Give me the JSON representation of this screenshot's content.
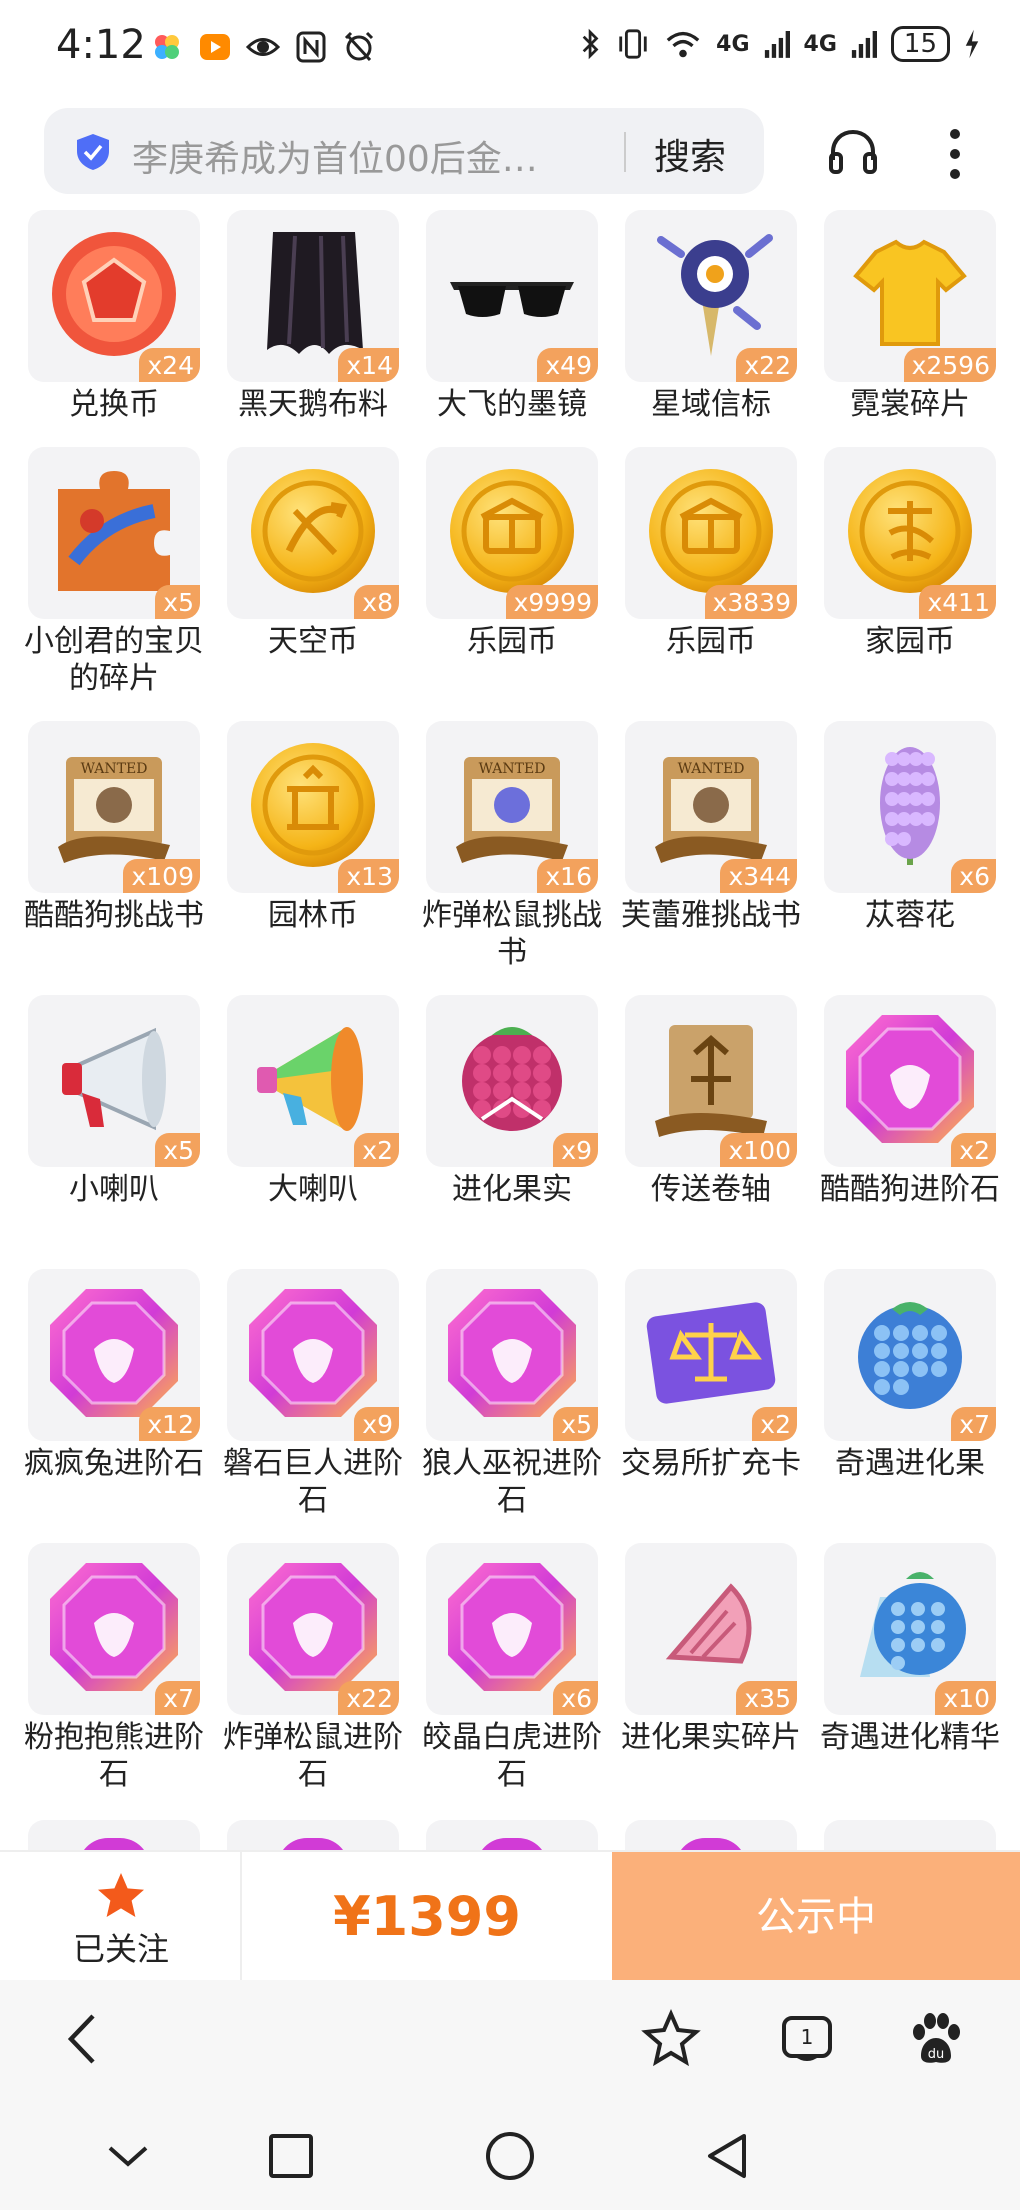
{
  "status_bar": {
    "time": "4:12",
    "battery": "15",
    "signal_1": "4G",
    "signal_2": "4G"
  },
  "browser": {
    "search_text": "李庚希成为首位00后金…",
    "search_button": "搜索"
  },
  "items": [
    {
      "name": "兑换币",
      "qty": "x24",
      "icon": "red-gem-coin-icon"
    },
    {
      "name": "黑天鹅布料",
      "qty": "x14",
      "icon": "black-cloth-icon"
    },
    {
      "name": "大飞的墨镜",
      "qty": "x49",
      "icon": "sunglasses-icon"
    },
    {
      "name": "星域信标",
      "qty": "x22",
      "icon": "star-beacon-icon"
    },
    {
      "name": "霓裳碎片",
      "qty": "x2596",
      "icon": "yellow-shirt-icon"
    },
    {
      "name": "小创君的宝贝的碎片",
      "qty": "x5",
      "icon": "puzzle-piece-icon"
    },
    {
      "name": "天空币",
      "qty": "x8",
      "icon": "sky-coin-icon"
    },
    {
      "name": "乐园币",
      "qty": "x9999",
      "icon": "park-coin-icon"
    },
    {
      "name": "乐园币",
      "qty": "x3839",
      "icon": "park-coin-icon"
    },
    {
      "name": "家园币",
      "qty": "x411",
      "icon": "home-coin-icon"
    },
    {
      "name": "酷酷狗挑战书",
      "qty": "x109",
      "icon": "wanted-scroll-icon"
    },
    {
      "name": "园林币",
      "qty": "x13",
      "icon": "garden-coin-icon"
    },
    {
      "name": "炸弹松鼠挑战书",
      "qty": "x16",
      "icon": "wanted-scroll-icon"
    },
    {
      "name": "芙蕾雅挑战书",
      "qty": "x344",
      "icon": "wanted-scroll-icon"
    },
    {
      "name": "苁蓉花",
      "qty": "x6",
      "icon": "purple-flower-icon"
    },
    {
      "name": "小喇叭",
      "qty": "x5",
      "icon": "small-megaphone-icon"
    },
    {
      "name": "大喇叭",
      "qty": "x2",
      "icon": "big-megaphone-icon"
    },
    {
      "name": "进化果实",
      "qty": "x9",
      "icon": "evolution-berry-icon"
    },
    {
      "name": "传送卷轴",
      "qty": "x100",
      "icon": "teleport-scroll-icon"
    },
    {
      "name": "酷酷狗进阶石",
      "qty": "x2",
      "icon": "advance-gem-icon"
    },
    {
      "name": "疯疯兔进阶石",
      "qty": "x12",
      "icon": "advance-gem-icon"
    },
    {
      "name": "磐石巨人进阶石",
      "qty": "x9",
      "icon": "advance-gem-icon"
    },
    {
      "name": "狼人巫祝进阶石",
      "qty": "x5",
      "icon": "advance-gem-icon"
    },
    {
      "name": "交易所扩充卡",
      "qty": "x2",
      "icon": "scale-card-icon"
    },
    {
      "name": "奇遇进化果",
      "qty": "x7",
      "icon": "blue-berry-icon"
    },
    {
      "name": "粉抱抱熊进阶石",
      "qty": "x7",
      "icon": "advance-gem-icon"
    },
    {
      "name": "炸弹松鼠进阶石",
      "qty": "x22",
      "icon": "advance-gem-icon"
    },
    {
      "name": "皎晶白虎进阶石",
      "qty": "x6",
      "icon": "advance-gem-icon"
    },
    {
      "name": "进化果实碎片",
      "qty": "x35",
      "icon": "berry-shard-icon"
    },
    {
      "name": "奇遇进化精华",
      "qty": "x10",
      "icon": "blue-essence-icon"
    }
  ],
  "action_bar": {
    "follow_label": "已关注",
    "price": "¥1399",
    "status_button": "公示中"
  },
  "colors": {
    "quantity_badge": "#f3a25d",
    "price": "#f07318",
    "status_button_bg": "#fbb07a",
    "gem_gradient": "#d13bd6"
  }
}
